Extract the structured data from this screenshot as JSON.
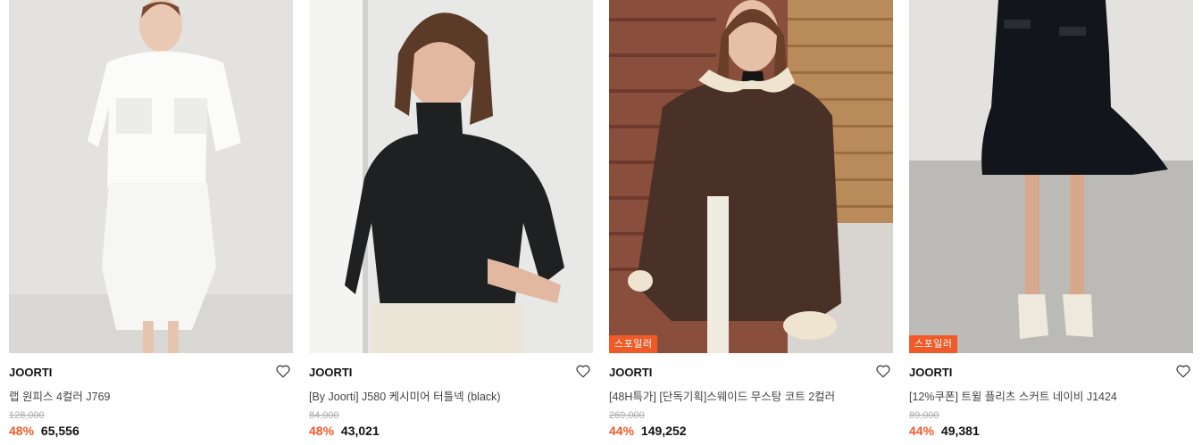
{
  "products": [
    {
      "brand": "JOORTI",
      "name": "랩 원피스 4컬러 J769",
      "original_price": "128,000",
      "discount": "48%",
      "price": "65,556",
      "badge": "",
      "photo": "model-white-wrap-dress"
    },
    {
      "brand": "JOORTI",
      "name": "[By Joorti] J580 케시미어 터틀넥 (black)",
      "original_price": "84,000",
      "discount": "48%",
      "price": "43,021",
      "badge": "",
      "photo": "model-black-turtleneck"
    },
    {
      "brand": "JOORTI",
      "name": "[48H특가] [단독기획]스웨이드 무스탕 코트 2컬러",
      "original_price": "269,000",
      "discount": "44%",
      "price": "149,252",
      "badge": "스포일러",
      "photo": "model-brown-suede-mustang-coat"
    },
    {
      "brand": "JOORTI",
      "name": "[12%쿠폰] 트윌 플리츠 스커트 네이비 J1424",
      "original_price": "89,000",
      "discount": "44%",
      "price": "49,381",
      "badge": "스포일러",
      "photo": "model-navy-pleats-skirt"
    }
  ],
  "icons": {
    "like": "heart-outline-icon"
  },
  "colors": {
    "discount": "#f05a28",
    "badge_bg": "#f05a28",
    "original_price": "#aaaaaa"
  }
}
